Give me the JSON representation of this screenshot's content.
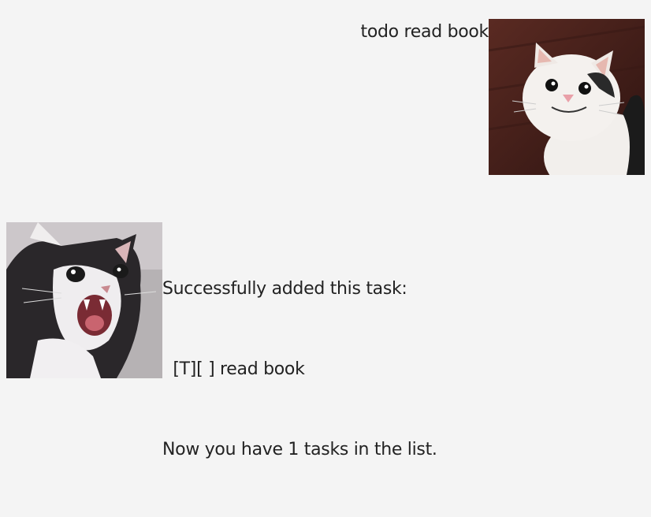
{
  "conversation": {
    "user_message": {
      "text": "todo read book",
      "avatar_icon": "smiling-cat-icon"
    },
    "bot_message": {
      "lines": [
        "Successfully added this task:",
        "  [T][ ] read book",
        "Now you have 1 tasks in the list."
      ],
      "avatar_icon": "screaming-cat-icon"
    }
  },
  "colors": {
    "background": "#f4f4f4",
    "text": "#222222"
  }
}
